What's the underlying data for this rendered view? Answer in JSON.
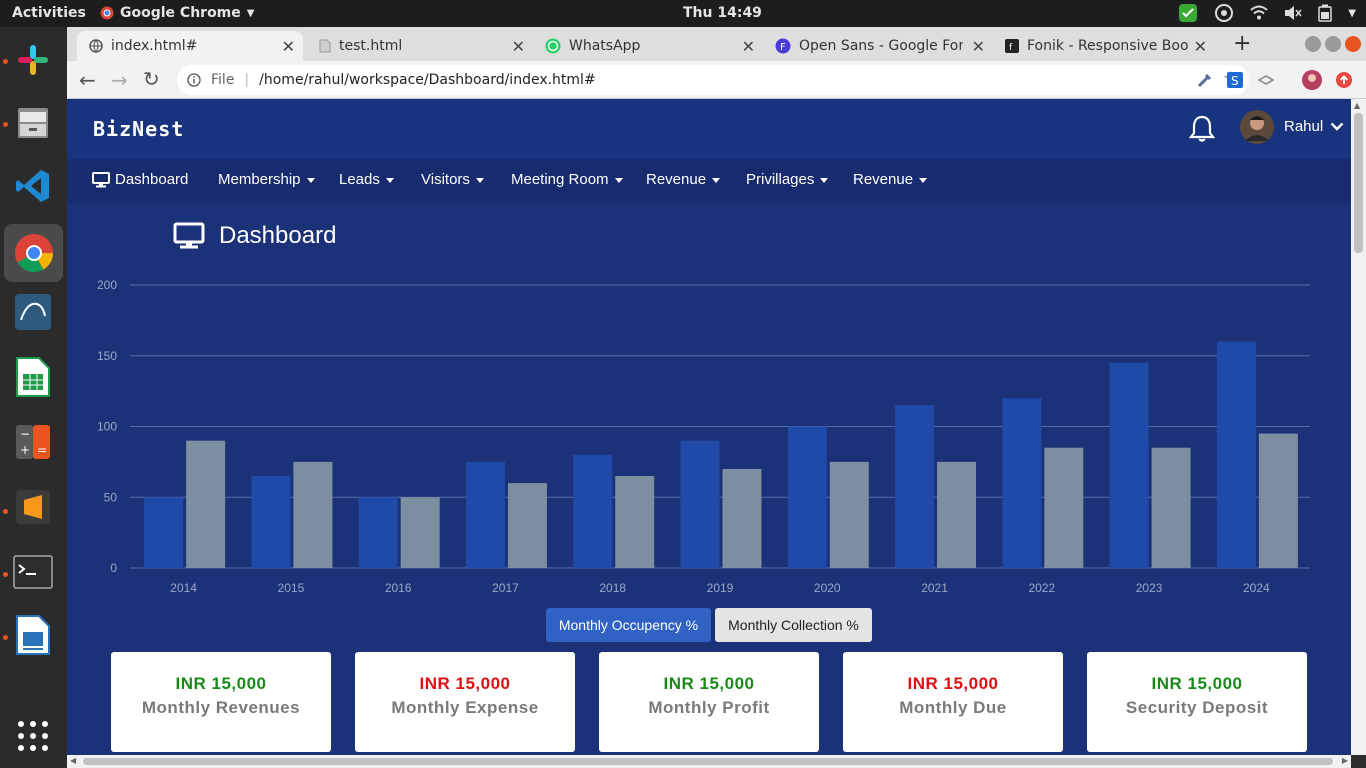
{
  "system": {
    "activities": "Activities",
    "app_menu": "Google Chrome",
    "clock": "Thu 14:49"
  },
  "browser": {
    "tabs": [
      {
        "title": "index.html#",
        "icon": "globe-icon",
        "active": true
      },
      {
        "title": "test.html",
        "icon": "document-icon",
        "active": false
      },
      {
        "title": "WhatsApp",
        "icon": "whatsapp-icon",
        "active": false
      },
      {
        "title": "Open Sans - Google Fonts",
        "icon": "google-fonts-icon",
        "active": false
      },
      {
        "title": "Fonik - Responsive Boot",
        "icon": "fonik-icon",
        "active": false
      }
    ],
    "address_prefix": "File",
    "url": "/home/rahul/workspace/Dashboard/index.html#"
  },
  "app": {
    "brand": "BizNest",
    "user_name": "Rahul",
    "nav": [
      {
        "label": "Dashboard",
        "has_caret": false
      },
      {
        "label": "Membership",
        "has_caret": true
      },
      {
        "label": "Leads",
        "has_caret": true
      },
      {
        "label": "Visitors",
        "has_caret": true
      },
      {
        "label": "Meeting Room",
        "has_caret": true
      },
      {
        "label": "Revenue",
        "has_caret": true
      },
      {
        "label": "Privillages",
        "has_caret": true
      },
      {
        "label": "Revenue",
        "has_caret": true
      }
    ],
    "page_title": "Dashboard",
    "toggles": [
      {
        "label": "Monthly Occupency %",
        "active": true
      },
      {
        "label": "Monthly Collection %",
        "active": false
      }
    ],
    "stats": [
      {
        "value": "INR 15,000",
        "label": "Monthly Revenues",
        "color": "#1a8a1a"
      },
      {
        "value": "INR 15,000",
        "label": "Monthly Expense",
        "color": "#e01010"
      },
      {
        "value": "INR 15,000",
        "label": "Monthly Profit",
        "color": "#1a8a1a"
      },
      {
        "value": "INR 15,000",
        "label": "Monthly Due",
        "color": "#e01010"
      },
      {
        "value": "INR 15,000",
        "label": "Security Deposit",
        "color": "#1a8a1a"
      }
    ]
  },
  "colors": {
    "series_a": "#1f4aa8",
    "series_b": "#7b8fa1"
  },
  "chart_data": {
    "type": "bar",
    "categories": [
      "2014",
      "2015",
      "2016",
      "2017",
      "2018",
      "2019",
      "2020",
      "2021",
      "2022",
      "2023",
      "2024"
    ],
    "series": [
      {
        "values": [
          50,
          65,
          50,
          75,
          80,
          90,
          100,
          115,
          120,
          145,
          160
        ]
      },
      {
        "values": [
          90,
          75,
          50,
          60,
          65,
          70,
          75,
          75,
          85,
          85,
          95
        ]
      }
    ],
    "yticks": [
      "0",
      "50",
      "100",
      "150",
      "200"
    ],
    "ylim": [
      0,
      200
    ],
    "grid": true,
    "title": "",
    "xlabel": "",
    "ylabel": ""
  }
}
